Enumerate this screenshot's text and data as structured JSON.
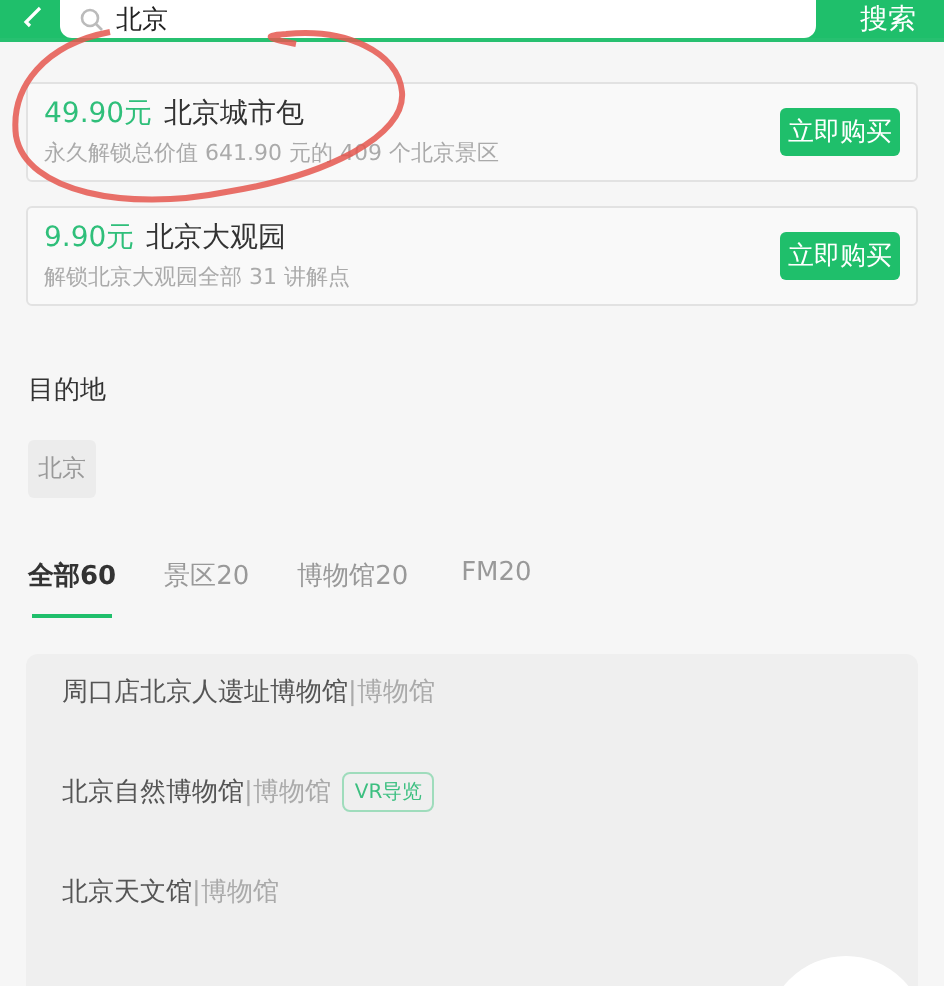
{
  "search": {
    "query": "北京",
    "button": "搜索"
  },
  "packages": [
    {
      "price": "49.90元",
      "title": "北京城市包",
      "description": "永久解锁总价值 641.90 元的 409 个北京景区",
      "button": "立即购买",
      "circled": true
    },
    {
      "price": "9.90元",
      "title": "北京大观园",
      "description": "解锁北京大观园全部 31 讲解点",
      "button": "立即购买",
      "circled": false
    }
  ],
  "destination": {
    "heading": "目的地",
    "chips": [
      "北京"
    ]
  },
  "tabs": [
    {
      "label": "全部60",
      "selected": true
    },
    {
      "label": "景区20",
      "selected": false
    },
    {
      "label": "博物馆20",
      "selected": false
    },
    {
      "label": "FM20",
      "selected": false
    }
  ],
  "results": [
    {
      "name": "周口店北京人遗址博物馆",
      "category": "|博物馆"
    },
    {
      "name": "北京自然博物馆",
      "category": "|博物馆",
      "badge": "VR导览"
    },
    {
      "name": "北京天文馆",
      "category": "|博物馆"
    }
  ]
}
